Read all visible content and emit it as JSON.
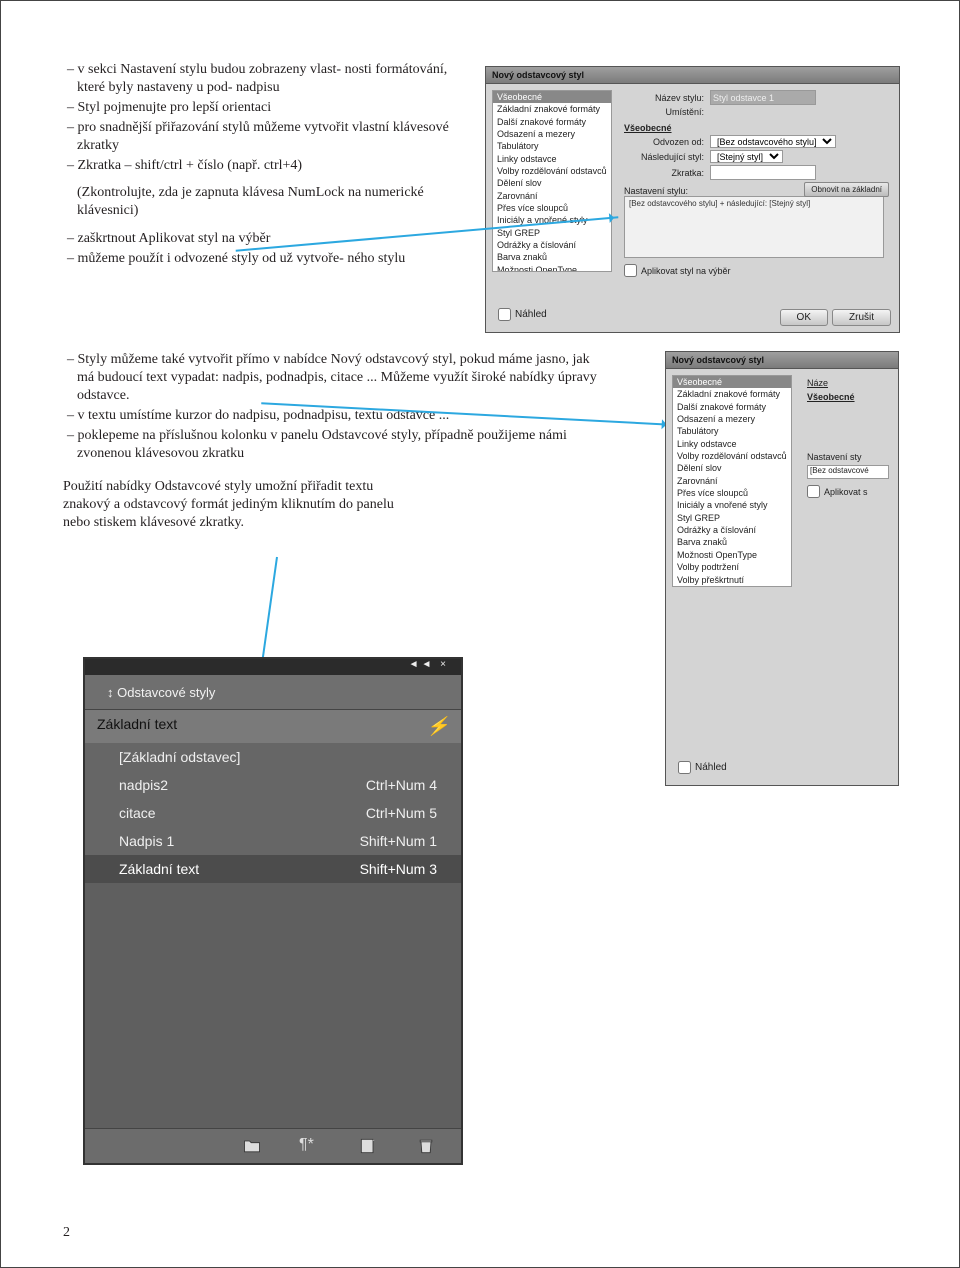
{
  "para1": {
    "li1": "v sekci Nastavení stylu budou zobrazeny vlast-\nnosti formátování, které byly nastaveny u pod-\nnadpisu",
    "li2": "Styl pojmenujte pro lepší orientaci",
    "li3": "pro snadnější přiřazování stylů můžeme vytvořit vlastní klávesové zkratky",
    "li4": "Zkratka – shift/ctrl + číslo (např. ctrl+4)",
    "paren": "(Zkontrolujte, zda je zapnuta klávesa NumLock na numerické klávesnici)",
    "li5": "zaškrtnout Aplikovat styl na výběr",
    "li6": "můžeme použít i odvozené styly od už vytvoře-\nného stylu"
  },
  "dlg1": {
    "title": "Nový odstavcový styl",
    "cats": [
      "Všeobecné",
      "Základní znakové formáty",
      "Další znakové formáty",
      "Odsazení a mezery",
      "Tabulátory",
      "Linky odstavce",
      "Volby rozdělování odstavců",
      "Dělení slov",
      "Zarovnání",
      "Přes více sloupců",
      "Iniciály a vnořené styly",
      "Styl GREP",
      "Odrážky a číslování",
      "Barva znaků",
      "Možnosti OpenType",
      "Volby podtržení",
      "Volby přeškrtnutí"
    ],
    "name_lbl": "Název stylu:",
    "name_val": "Styl odstavce 1",
    "umisteni": "Umístění:",
    "section": "Všeobecné",
    "based_lbl": "Odvozen od:",
    "based_val": "[Bez odstavcového stylu]",
    "next_lbl": "Následující styl:",
    "next_val": "[Stejný styl]",
    "short_lbl": "Zkratka:",
    "settings_lbl": "Nastavení stylu:",
    "settings_val": "[Bez odstavcového stylu] + následující: [Stejný styl]",
    "restore": "Obnovit na základní",
    "apply_chk": "Aplikovat styl na výběr",
    "preview": "Náhled",
    "ok": "OK",
    "cancel": "Zrušit"
  },
  "para2": {
    "li1": "Styly můžeme také vytvořit přímo v nabídce Nový odstavcový styl, pokud máme jasno, jak má budoucí text vypadat: nadpis, podnadpis, citace ... Můžeme využít široké nabídky úpravy odstavce.",
    "li2": "v textu umístíme kurzor do nadpisu, podnadpisu, textu odstavce ...",
    "li3": "poklepeme na příslušnou kolonku v panelu Odstavcové styly, případně použijeme námi zvonenou klávesovou zkratku",
    "note": "Použití nabídky Odstavcové styly umožní přiřadit textu\nznakový a odstavcový formát jediným kliknutím do panelu\nnebo stiskem klávesové zkratky."
  },
  "dlg2": {
    "title": "Nový odstavcový styl",
    "name_lbl": "Náze",
    "section": "Všeobecné",
    "settings_lbl": "Nastavení sty",
    "settings_val": "[Bez odstavcové",
    "apply_chk": "Aplikovat s",
    "preview": "Náhled"
  },
  "panel": {
    "tab": "Odstavcové styly",
    "head": "Základní text",
    "rows": [
      {
        "name": "[Základní odstavec]",
        "short": ""
      },
      {
        "name": "nadpis2",
        "short": "Ctrl+Num 4"
      },
      {
        "name": "citace",
        "short": "Ctrl+Num 5"
      },
      {
        "name": "Nadpis 1",
        "short": "Shift+Num 1"
      },
      {
        "name": "Základní text",
        "short": "Shift+Num 3"
      }
    ],
    "icon_collapse": "◄◄ ×"
  },
  "page": "2"
}
